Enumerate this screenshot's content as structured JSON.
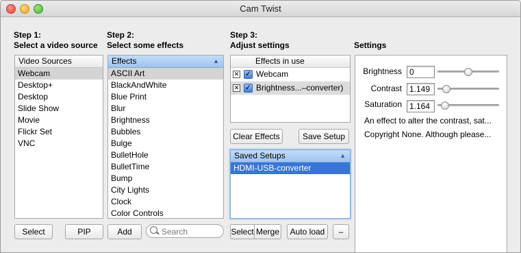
{
  "window": {
    "title": "Cam Twist"
  },
  "step1": {
    "heading": "Step 1:",
    "subheading": "Select a video source",
    "column_header": "Video Sources",
    "items": [
      "Webcam",
      "Desktop+",
      "Desktop",
      "Slide Show",
      "Movie",
      "Flickr Set",
      "VNC"
    ],
    "selected": "Webcam",
    "select_button": "Select",
    "pip_button": "PIP"
  },
  "step2": {
    "heading": "Step 2:",
    "subheading": "Select some effects",
    "column_header": "Effects",
    "items": [
      "ASCII Art",
      "BlackAndWhite",
      "Blue Print",
      "Blur",
      "Brightness",
      "Bubbles",
      "Bulge",
      "BulletHole",
      "BulletTime",
      "Bump",
      "City Lights",
      "Clock",
      "Color Controls"
    ],
    "selected": "ASCII Art",
    "add_button": "Add",
    "search_placeholder": "Search"
  },
  "step3": {
    "heading": "Step 3:",
    "subheading": "Adjust settings",
    "column_header": "Effects in use",
    "effects_in_use": [
      {
        "label": "Webcam",
        "enabled": true,
        "selected": false
      },
      {
        "label": "Brightness...–converter)",
        "enabled": true,
        "selected": true
      }
    ],
    "remove_glyph": "✕",
    "check_glyph": "✓",
    "clear_effects_button": "Clear Effects",
    "save_setup_button": "Save Setup",
    "saved_setups_header": "Saved Setups",
    "saved_setups": [
      "HDMI-USB-converter"
    ],
    "selected_setup": "HDMI-USB-converter",
    "select_button": "Select",
    "merge_button": "Merge",
    "auto_load_button": "Auto load",
    "minus_button": "–"
  },
  "settings": {
    "heading": "Settings",
    "brightness_label": "Brightness",
    "brightness_value": "0",
    "brightness_slider_fraction": 0.5,
    "contrast_label": "Contrast",
    "contrast_value": "1.149",
    "contrast_slider_fraction": 0.09,
    "saturation_label": "Saturation",
    "saturation_value": "1.164",
    "saturation_slider_fraction": 0.06,
    "description": "An effect to alter the contrast, sat...",
    "copyright": "Copyright None. Although please..."
  }
}
